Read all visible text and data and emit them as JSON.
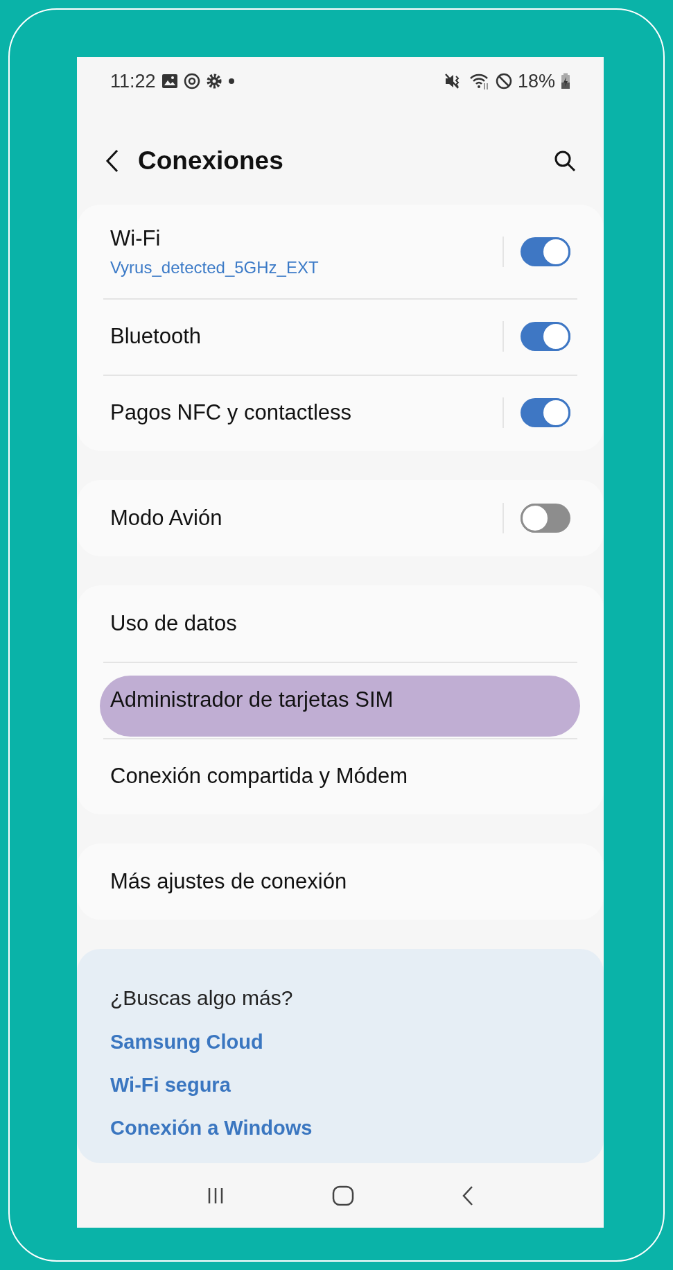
{
  "status_bar": {
    "time": "11:22",
    "battery": "18%"
  },
  "header": {
    "title": "Conexiones"
  },
  "groups": [
    {
      "items": [
        {
          "kind": "toggle",
          "label": "Wi-Fi",
          "subtitle": "Vyrus_detected_5GHz_EXT",
          "on": true,
          "highlighted": false
        },
        {
          "kind": "toggle",
          "label": "Bluetooth",
          "on": true,
          "highlighted": false
        },
        {
          "kind": "toggle",
          "label": "Pagos NFC y contactless",
          "on": true,
          "highlighted": false
        }
      ]
    },
    {
      "items": [
        {
          "kind": "toggle",
          "label": "Modo Avión",
          "on": false,
          "highlighted": false
        }
      ]
    },
    {
      "items": [
        {
          "kind": "link",
          "label": "Uso de datos",
          "highlighted": false
        },
        {
          "kind": "link",
          "label": "Administrador de tarjetas SIM",
          "highlighted": true
        },
        {
          "kind": "link",
          "label": "Conexión compartida y Módem",
          "highlighted": false
        }
      ]
    },
    {
      "items": [
        {
          "kind": "link",
          "label": "Más ajustes de conexión",
          "highlighted": false
        }
      ]
    }
  ],
  "suggestions": {
    "title": "¿Buscas algo más?",
    "links": [
      "Samsung Cloud",
      "Wi-Fi segura",
      "Conexión a Windows"
    ]
  }
}
